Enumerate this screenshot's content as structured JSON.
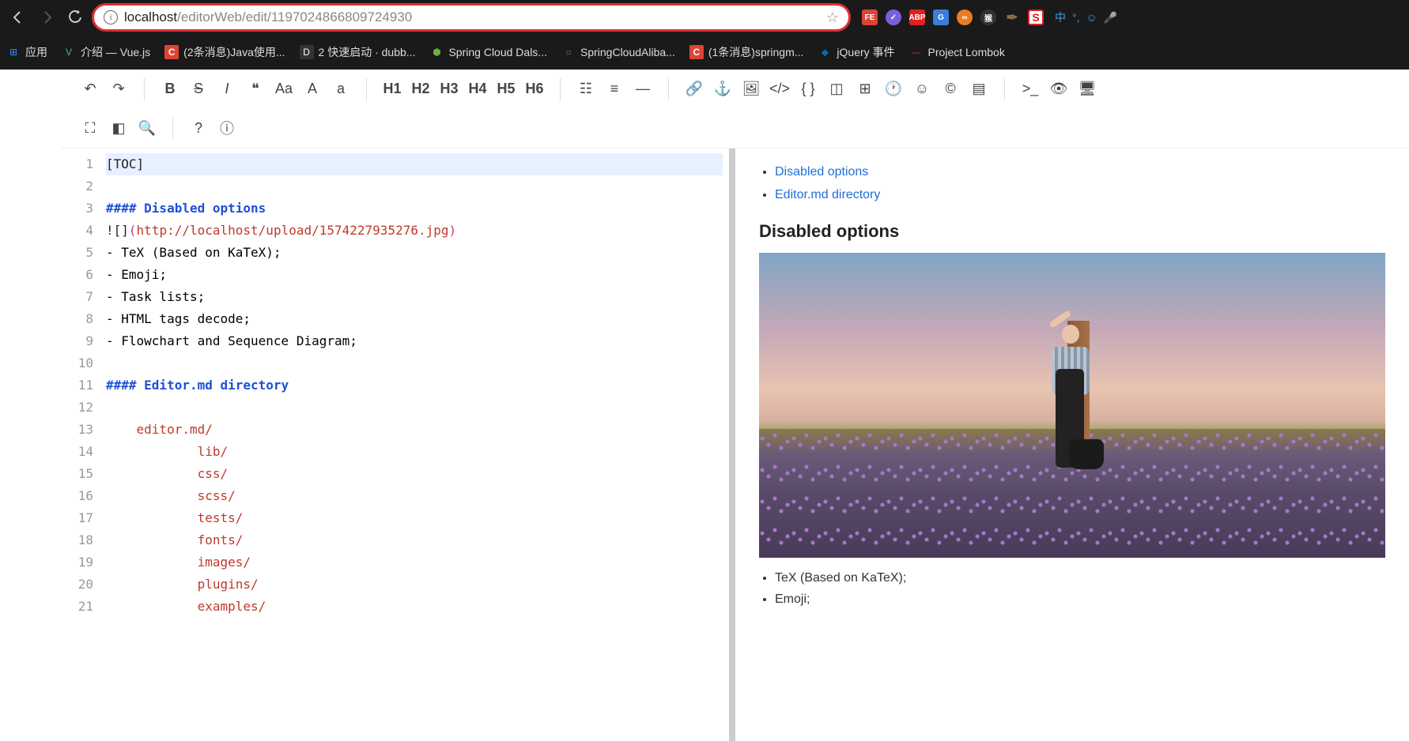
{
  "browser": {
    "url_host": "localhost",
    "url_path": "/editorWeb/edit/1197024866809724930",
    "extensions": [
      "FE",
      "✓",
      "ABP",
      "G",
      "∞",
      "猴",
      "✒",
      "S"
    ],
    "status": [
      "中",
      "°,",
      "☺",
      "🎤"
    ]
  },
  "bookmarks": [
    {
      "icon": "apps",
      "glyph": "⊞",
      "label": "应用"
    },
    {
      "icon": "vue",
      "glyph": "V",
      "label": "介绍 — Vue.js"
    },
    {
      "icon": "csdn",
      "glyph": "C",
      "label": "(2条消息)Java使用..."
    },
    {
      "icon": "dubbo",
      "glyph": "D",
      "label": "2 快速启动 · dubb..."
    },
    {
      "icon": "spring",
      "glyph": "⬢",
      "label": "Spring Cloud Dals..."
    },
    {
      "icon": "github",
      "glyph": "○",
      "label": "SpringCloudAliba..."
    },
    {
      "icon": "csdn",
      "glyph": "C",
      "label": "(1条消息)springm..."
    },
    {
      "icon": "jquery",
      "glyph": "◆",
      "label": "jQuery 事件"
    },
    {
      "icon": "lombok",
      "glyph": "—",
      "label": "Project Lombok"
    }
  ],
  "toolbar": {
    "row1": {
      "g1": [
        "↶",
        "↷"
      ],
      "g2": [
        "B",
        "S",
        "I",
        "❝",
        "Aa",
        "A",
        "a"
      ],
      "headings": [
        "H1",
        "H2",
        "H3",
        "H4",
        "H5",
        "H6"
      ],
      "g3": [
        "☷",
        "≡",
        "—"
      ],
      "g4": [
        "🔗",
        "⚓",
        "🖼",
        "</>",
        "{ }",
        "◫",
        "⊞",
        "🕐",
        "☺",
        "©",
        "▤"
      ],
      "g5": [
        ">_",
        "👁",
        "🖥"
      ]
    },
    "row2": {
      "g1": [
        "⛶",
        "◧",
        "🔍"
      ],
      "g2": [
        "?",
        "ⓘ"
      ]
    }
  },
  "editor": {
    "lines": [
      {
        "n": 1,
        "t": "toc",
        "text": "[TOC]",
        "hl": true
      },
      {
        "n": 2,
        "t": "blank"
      },
      {
        "n": 3,
        "t": "header",
        "text": "#### Disabled options"
      },
      {
        "n": 4,
        "t": "img",
        "pre": "![]",
        "op": "(",
        "url": "http://localhost/upload/1574227935276.jpg",
        "cp": ")"
      },
      {
        "n": 5,
        "t": "plain",
        "text": "- TeX (Based on KaTeX);"
      },
      {
        "n": 6,
        "t": "plain",
        "text": "- Emoji;"
      },
      {
        "n": 7,
        "t": "plain",
        "text": "- Task lists;"
      },
      {
        "n": 8,
        "t": "plain",
        "text": "- HTML tags decode;"
      },
      {
        "n": 9,
        "t": "plain",
        "text": "- Flowchart and Sequence Diagram;"
      },
      {
        "n": 10,
        "t": "blank"
      },
      {
        "n": 11,
        "t": "header",
        "text": "#### Editor.md directory"
      },
      {
        "n": 12,
        "t": "blank"
      },
      {
        "n": 13,
        "t": "dir",
        "indent": "    ",
        "text": "editor.md/"
      },
      {
        "n": 14,
        "t": "dir",
        "indent": "            ",
        "text": "lib/"
      },
      {
        "n": 15,
        "t": "dir",
        "indent": "            ",
        "text": "css/"
      },
      {
        "n": 16,
        "t": "dir",
        "indent": "            ",
        "text": "scss/"
      },
      {
        "n": 17,
        "t": "dir",
        "indent": "            ",
        "text": "tests/"
      },
      {
        "n": 18,
        "t": "dir",
        "indent": "            ",
        "text": "fonts/"
      },
      {
        "n": 19,
        "t": "dir",
        "indent": "            ",
        "text": "images/"
      },
      {
        "n": 20,
        "t": "dir",
        "indent": "            ",
        "text": "plugins/"
      },
      {
        "n": 21,
        "t": "dir",
        "indent": "            ",
        "text": "examples/"
      }
    ]
  },
  "preview": {
    "toc": [
      "Disabled options",
      "Editor.md directory"
    ],
    "heading1": "Disabled options",
    "list1": [
      "TeX (Based on KaTeX);",
      "Emoji;"
    ]
  }
}
